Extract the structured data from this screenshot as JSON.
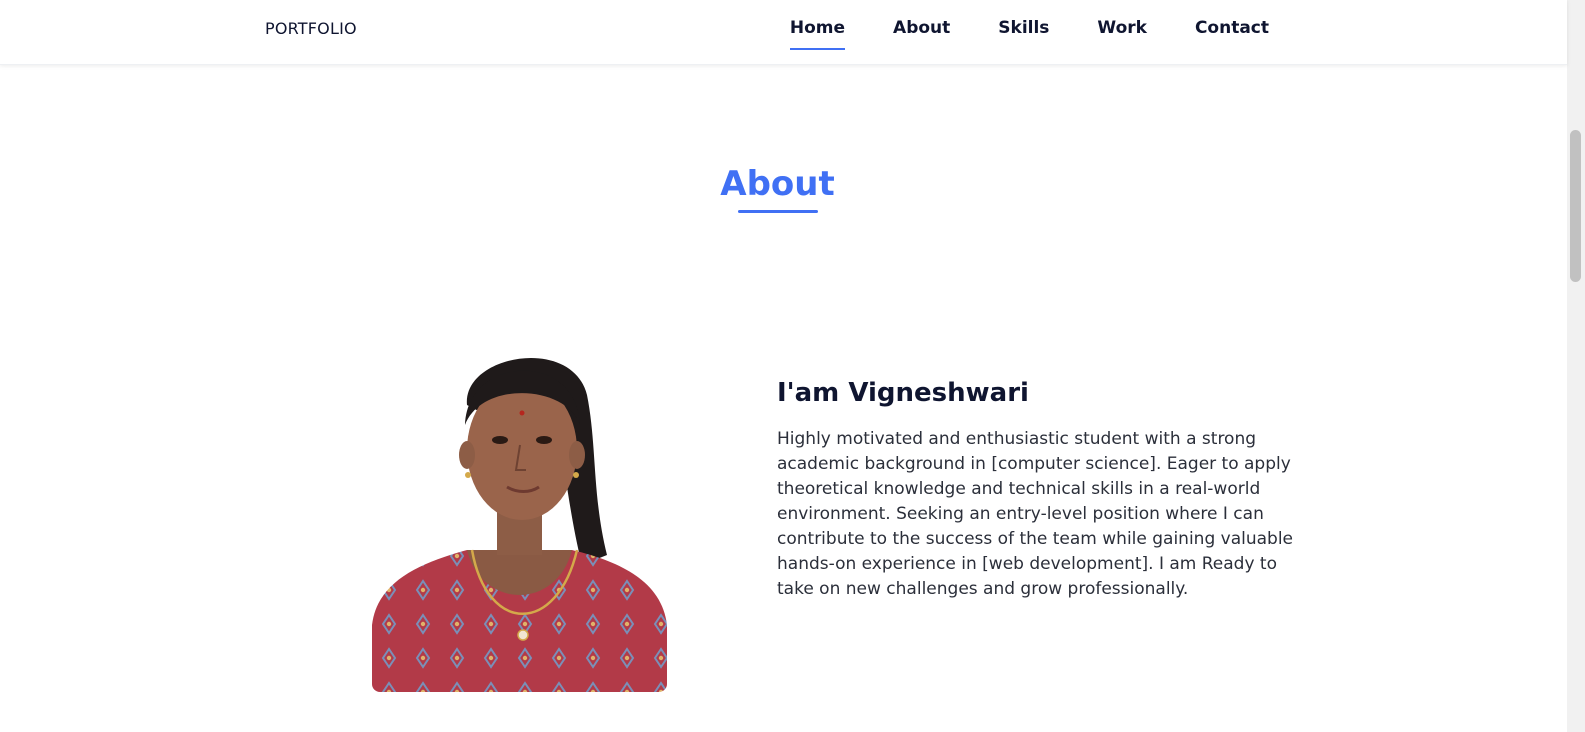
{
  "header": {
    "logo": "PORTFOLIO",
    "nav": [
      {
        "label": "Home",
        "active": true
      },
      {
        "label": "About",
        "active": false
      },
      {
        "label": "Skills",
        "active": false
      },
      {
        "label": "Work",
        "active": false
      },
      {
        "label": "Contact",
        "active": false
      }
    ]
  },
  "about": {
    "section_title": "About",
    "heading": "I'am Vigneshwari",
    "paragraph": "Highly motivated and enthusiastic student with a strong academic background in [computer science]. Eager to apply theoretical knowledge and technical skills in a real-world environment. Seeking an entry-level position where I can contribute to the success of the team while gaining valuable hands-on experience in [web development]. I am Ready to take on new challenges and grow professionally."
  },
  "colors": {
    "accent": "#4070f4",
    "text_dark": "#0f1530",
    "shirt": "#b23a48"
  }
}
